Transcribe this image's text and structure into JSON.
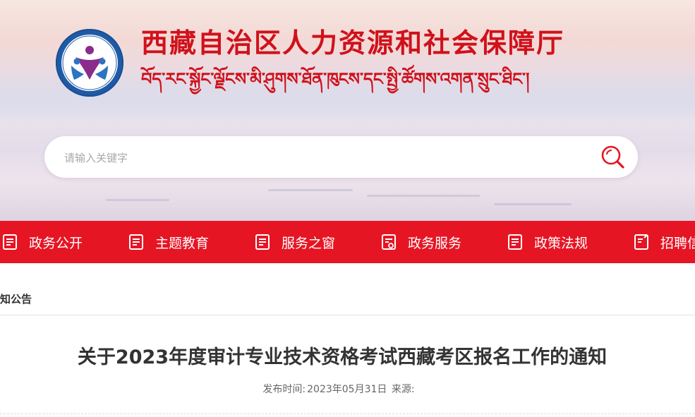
{
  "site": {
    "title_cn": "西藏自治区人力资源和社会保障厅",
    "title_bo": "བོད་རང་སྐྱོང་ལྗོངས་མི་ཤུགས་ཐོན་ཁུངས་དང་སྤྱི་ཚོགས་འགན་སྲུང་ཐིང་།",
    "logo_icon": "people-emblem-icon"
  },
  "search": {
    "placeholder": "请输入关键字",
    "value": "",
    "icon": "search-icon"
  },
  "nav": {
    "items": [
      {
        "label": "政务公开",
        "icon": "document-list-icon"
      },
      {
        "label": "主题教育",
        "icon": "document-list-icon"
      },
      {
        "label": "服务之窗",
        "icon": "document-list-icon"
      },
      {
        "label": "政务服务",
        "icon": "document-check-icon"
      },
      {
        "label": "政策法规",
        "icon": "document-list-icon"
      },
      {
        "label": "招聘信",
        "icon": "document-edit-icon"
      }
    ]
  },
  "breadcrumb": {
    "current": "知公告"
  },
  "article": {
    "title": "关于2023年度审计专业技术资格考试西藏考区报名工作的通知",
    "publish_label": "发布时间:",
    "publish_date": "2023年05月31日",
    "source_label": "来源:"
  },
  "colors": {
    "brand_red": "#e61524",
    "title_red": "#d0111b",
    "logo_blue": "#1f5aa6"
  }
}
